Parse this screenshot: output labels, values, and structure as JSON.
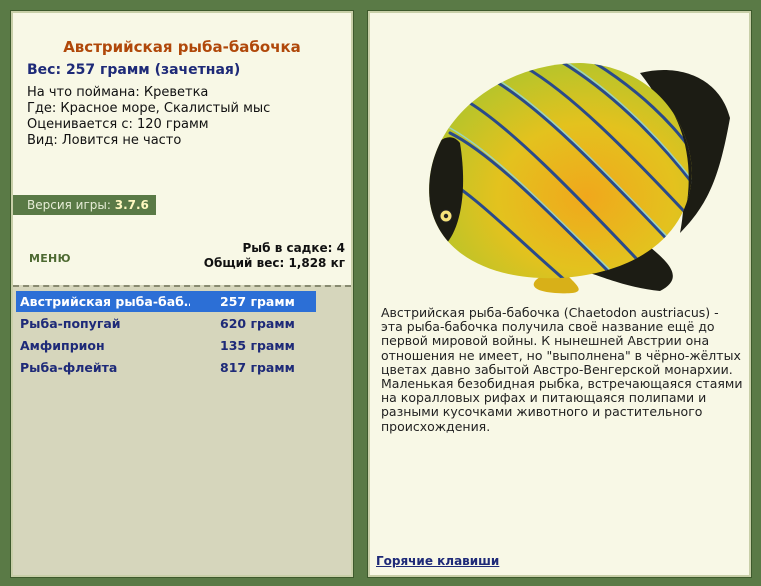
{
  "fish": {
    "title": "Австрийская рыба-бабочка",
    "weight": "Вес: 257 грамм (зачетная)",
    "bait": "На что поймана: Креветка",
    "location": "Где: Красное море, Скалистый мыс",
    "rated_from": "Оценивается с: 120 грамм",
    "kind": "Вид: Ловится не часто",
    "image_icon": "butterflyfish-illustration"
  },
  "version": {
    "label": "Версия игры:",
    "value": "3.7.6"
  },
  "menu": {
    "label": "МЕНЮ"
  },
  "stats": {
    "count": "Рыб в садке: 4",
    "total": "Общий вес: 1,828 кг"
  },
  "catch_list": [
    {
      "name": "Австрийская рыба-баб…",
      "weight": "257 грамм",
      "selected": true
    },
    {
      "name": "Рыба-попугай",
      "weight": "620 грамм",
      "selected": false
    },
    {
      "name": "Амфиприон",
      "weight": "135 грамм",
      "selected": false
    },
    {
      "name": "Рыба-флейта",
      "weight": "817 грамм",
      "selected": false
    }
  ],
  "description": "Австрийская рыба-бабочка (Chaetodon austriacus) - эта рыба-бабочка получила своё название ещё до первой мировой войны. К нынешней Австрии она отношения не имеет, но \"выполнена\" в чёрно-жёлтых цветах давно забытой Австро-Венгерской монархии. Маленькая безобидная рыбка, встречающаяся стаями на коралловых рифах и питающаяся полипами и разными кусочками животного и растительного происхождения.",
  "hotkeys": {
    "label": "Горячие клавиши"
  },
  "colors": {
    "background": "#5a7a46",
    "panel": "#f8f8e6",
    "title": "#b0480a",
    "accent": "#1e2a78",
    "selection": "#2c6fd6",
    "list_bg": "#d6d6bc"
  }
}
